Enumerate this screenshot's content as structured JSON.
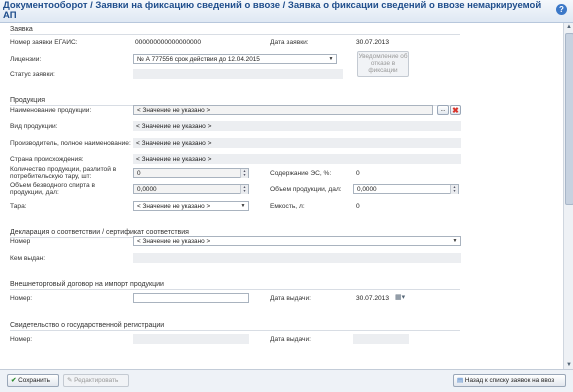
{
  "title": "Документооборот / Заявки на фиксацию сведений о ввозе / Заявка о фиксации сведений о ввозе немаркируемой АП",
  "sections": {
    "request": "Заявка",
    "product": "Продукция",
    "declaration": "Декларация о соответствии / сертификат соответствия",
    "contract": "Внешнеторговый договор на импорт продукции",
    "registration": "Свидетельство о государственной регистрации"
  },
  "request": {
    "egais_label": "Номер заявки ЕГАИС:",
    "egais_value": "000000000000000000",
    "date_label": "Дата заявки:",
    "date_value": "30.07.2013",
    "license_label": "Лицензии:",
    "license_value": "№ А 777556 срок действия до 12.04.2015",
    "status_label": "Статус заявки:",
    "refusal_button": "Уведомление об отказе в фиксации"
  },
  "product": {
    "name_label": "Наименование продукции:",
    "name_value": "< Значение не указано >",
    "type_label": "Вид продукции:",
    "type_value": "< Значение не указано >",
    "producer_label": "Производитель, полное наименование:",
    "producer_value": "< Значение не указано >",
    "country_label": "Страна происхождения:",
    "country_value": "< Значение не указано >",
    "qty_label": "Количество продукции, разлитой в потребительскую тару, шт:",
    "qty_value": "0",
    "es_label": "Содержание ЭС, %:",
    "es_value": "0",
    "spirit_label": "Объем безводного спирта в продукции, дал:",
    "spirit_value": "0,0000",
    "volume_label": "Объем продукции, дал:",
    "volume_value": "0,0000",
    "tara_label": "Тара:",
    "tara_value": "< Значение не указано >",
    "capacity_label": "Емкость, л:",
    "capacity_value": "0"
  },
  "declaration": {
    "number_label": "Номер",
    "number_value": "< Значение не указано >",
    "issuer_label": "Кем выдан:"
  },
  "contract": {
    "number_label": "Номер:",
    "number_value": "",
    "date_label": "Дата выдачи:",
    "date_value": "30.07.2013"
  },
  "registration": {
    "number_label": "Номер:",
    "date_label": "Дата выдачи:"
  },
  "footer": {
    "save": "Сохранить",
    "edit": "Редактировать",
    "back": "Назад к списку заявок на ввоз"
  },
  "colors": {
    "title": "#1f4e8c",
    "accent": "#3b78c8",
    "delete": "#d9342b",
    "save_icon": "#2e8b2e"
  }
}
